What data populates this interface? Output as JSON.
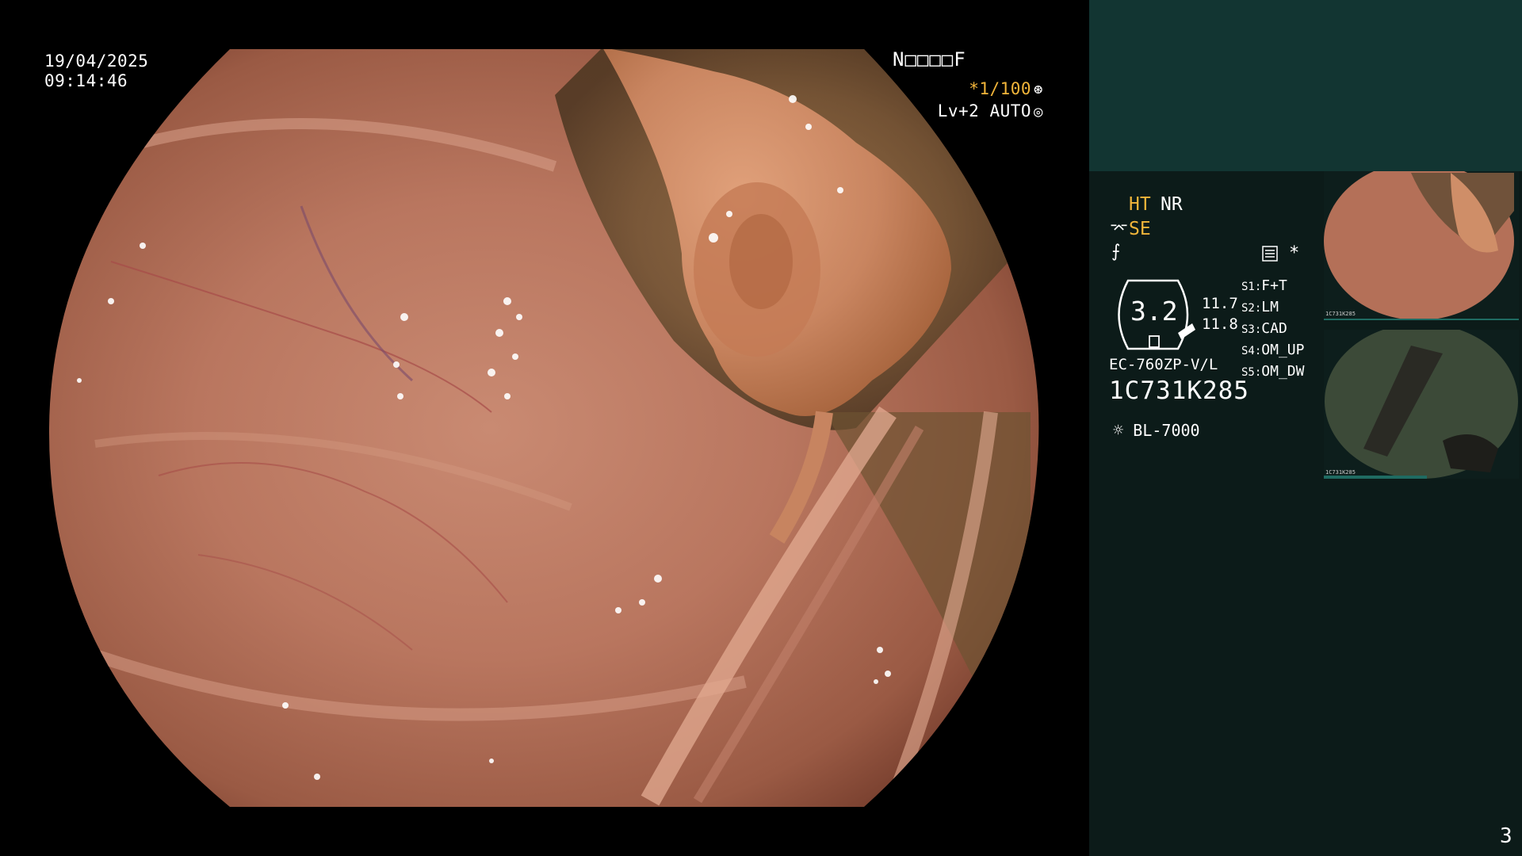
{
  "overlay": {
    "date": "19/04/2025",
    "time": "09:14:46",
    "code": "N□□□□F",
    "shutter": "*1/100",
    "level": "Lv+2 AUTO"
  },
  "panel": {
    "ht_label": "HT",
    "nr_label": "NR",
    "se_label": "SE",
    "gauge_value": "3.2",
    "value_top": "11.7",
    "value_bottom": "11.8",
    "scope_model": "EC-760ZP-V/L",
    "serial": "1C731K285",
    "light_source": "BL-7000",
    "page_number": "3",
    "switches": [
      {
        "key": "S1:",
        "value": "F+T"
      },
      {
        "key": "S2:",
        "value": "LM"
      },
      {
        "key": "S3:",
        "value": "CAD"
      },
      {
        "key": "S4:",
        "value": "OM_UP"
      },
      {
        "key": "S5:",
        "value": "OM_DW"
      }
    ]
  },
  "thumbnails": [
    {
      "caption": "1C731K285"
    },
    {
      "caption": "1C731K285"
    }
  ],
  "colors": {
    "accent": "#f2b53a",
    "panel_bg": "#0c1b19",
    "panel_top": "#123532"
  },
  "icons": [
    "shutter-wheel-icon",
    "auto-ring-icon",
    "enhance-icon",
    "freeze-icon",
    "document-icon",
    "lamp-icon"
  ]
}
